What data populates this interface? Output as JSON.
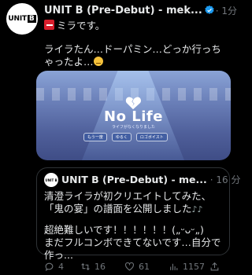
{
  "tweet": {
    "avatar_text": "UNIT",
    "avatar_text_b": "B",
    "display_name": "UNIT B (Pre-Debut) - mek...",
    "time": "· 1分",
    "sender": "ミラです。",
    "body": "ライラたん…ドーパミン…どっか行っちゃったよ…",
    "media": {
      "song_title": "No Life",
      "subtitle": "ライフがなくなりました",
      "pills": [
        "もう一度",
        "ゆるく",
        "ロゴボイスト"
      ]
    },
    "quote": {
      "avatar_text": "UNIT B",
      "display_name": "UNIT B (Pre-Debut) - me...",
      "time": "· 16 分",
      "line1": "清澄ライラが初クリエイトしてみた、「鬼の宴」の譜面を公開しました",
      "notes": "♪♪",
      "line2": "超絶難しいです！！！！！！(„ᵕᴗᵕ„)",
      "line3": "まだフルコンボできてないです…自分で作っ..."
    },
    "actions": {
      "replies": "4",
      "retweets": "16",
      "likes": "61",
      "views": "1157"
    }
  }
}
